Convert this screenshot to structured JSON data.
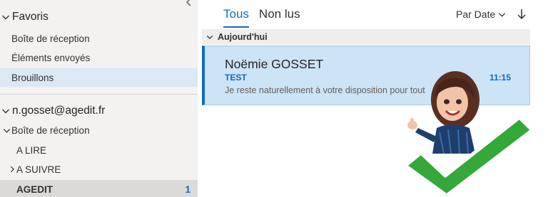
{
  "sidebar": {
    "favorites": {
      "title": "Favoris",
      "items": [
        {
          "label": "Boîte de réception"
        },
        {
          "label": "Éléments envoyés"
        },
        {
          "label": "Brouillons"
        }
      ]
    },
    "account": {
      "title": "n.gosset@agedit.fr",
      "inbox_label": "Boîte de réception",
      "sub_items": [
        {
          "label": "A LIRE"
        },
        {
          "label": "A SUIVRE"
        },
        {
          "label": "AGEDIT",
          "count": "1"
        }
      ]
    }
  },
  "main": {
    "tabs": [
      {
        "label": "Tous",
        "active": true
      },
      {
        "label": "Non lus",
        "active": false
      }
    ],
    "sort_label": "Par Date",
    "group_label": "Aujourd'hui",
    "message": {
      "sender": "Noëmie GOSSET",
      "subject": "TEST",
      "time": "11:15",
      "preview": "Je reste naturellement à votre disposition pour tout"
    }
  },
  "colors": {
    "accent": "#0f6cbd",
    "selected_message_bg": "#cde3f6",
    "checkmark_green": "#35a83a"
  },
  "icons": [
    "chevron-down-icon",
    "chevron-right-icon",
    "chevron-left-icon",
    "sort-down-arrow-icon"
  ]
}
